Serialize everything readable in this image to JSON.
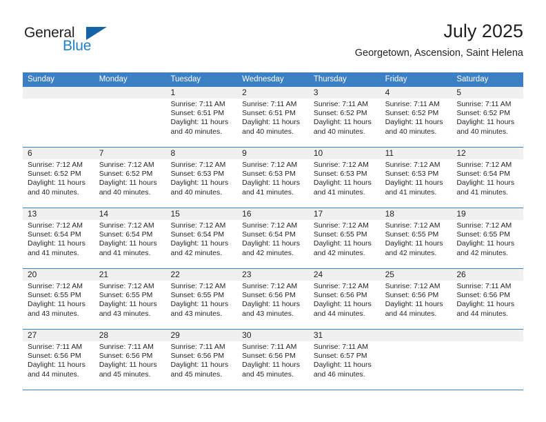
{
  "brand": {
    "name_top": "General",
    "name_bottom": "Blue",
    "triangle_color": "#1464a5",
    "blue_color": "#1f7fc4"
  },
  "header": {
    "title": "July 2025",
    "subtitle": "Georgetown, Ascension, Saint Helena"
  },
  "theme": {
    "header_blue": "#3b7fc4",
    "datenum_bg": "#f0f0f0",
    "text": "#231f20"
  },
  "weekdays": [
    "Sunday",
    "Monday",
    "Tuesday",
    "Wednesday",
    "Thursday",
    "Friday",
    "Saturday"
  ],
  "weeks": [
    [
      {
        "day": "",
        "sunrise": "",
        "sunset": "",
        "daylight1": "",
        "daylight2": ""
      },
      {
        "day": "",
        "sunrise": "",
        "sunset": "",
        "daylight1": "",
        "daylight2": ""
      },
      {
        "day": "1",
        "sunrise": "Sunrise: 7:11 AM",
        "sunset": "Sunset: 6:51 PM",
        "daylight1": "Daylight: 11 hours",
        "daylight2": "and 40 minutes."
      },
      {
        "day": "2",
        "sunrise": "Sunrise: 7:11 AM",
        "sunset": "Sunset: 6:51 PM",
        "daylight1": "Daylight: 11 hours",
        "daylight2": "and 40 minutes."
      },
      {
        "day": "3",
        "sunrise": "Sunrise: 7:11 AM",
        "sunset": "Sunset: 6:52 PM",
        "daylight1": "Daylight: 11 hours",
        "daylight2": "and 40 minutes."
      },
      {
        "day": "4",
        "sunrise": "Sunrise: 7:11 AM",
        "sunset": "Sunset: 6:52 PM",
        "daylight1": "Daylight: 11 hours",
        "daylight2": "and 40 minutes."
      },
      {
        "day": "5",
        "sunrise": "Sunrise: 7:11 AM",
        "sunset": "Sunset: 6:52 PM",
        "daylight1": "Daylight: 11 hours",
        "daylight2": "and 40 minutes."
      }
    ],
    [
      {
        "day": "6",
        "sunrise": "Sunrise: 7:12 AM",
        "sunset": "Sunset: 6:52 PM",
        "daylight1": "Daylight: 11 hours",
        "daylight2": "and 40 minutes."
      },
      {
        "day": "7",
        "sunrise": "Sunrise: 7:12 AM",
        "sunset": "Sunset: 6:52 PM",
        "daylight1": "Daylight: 11 hours",
        "daylight2": "and 40 minutes."
      },
      {
        "day": "8",
        "sunrise": "Sunrise: 7:12 AM",
        "sunset": "Sunset: 6:53 PM",
        "daylight1": "Daylight: 11 hours",
        "daylight2": "and 40 minutes."
      },
      {
        "day": "9",
        "sunrise": "Sunrise: 7:12 AM",
        "sunset": "Sunset: 6:53 PM",
        "daylight1": "Daylight: 11 hours",
        "daylight2": "and 41 minutes."
      },
      {
        "day": "10",
        "sunrise": "Sunrise: 7:12 AM",
        "sunset": "Sunset: 6:53 PM",
        "daylight1": "Daylight: 11 hours",
        "daylight2": "and 41 minutes."
      },
      {
        "day": "11",
        "sunrise": "Sunrise: 7:12 AM",
        "sunset": "Sunset: 6:53 PM",
        "daylight1": "Daylight: 11 hours",
        "daylight2": "and 41 minutes."
      },
      {
        "day": "12",
        "sunrise": "Sunrise: 7:12 AM",
        "sunset": "Sunset: 6:54 PM",
        "daylight1": "Daylight: 11 hours",
        "daylight2": "and 41 minutes."
      }
    ],
    [
      {
        "day": "13",
        "sunrise": "Sunrise: 7:12 AM",
        "sunset": "Sunset: 6:54 PM",
        "daylight1": "Daylight: 11 hours",
        "daylight2": "and 41 minutes."
      },
      {
        "day": "14",
        "sunrise": "Sunrise: 7:12 AM",
        "sunset": "Sunset: 6:54 PM",
        "daylight1": "Daylight: 11 hours",
        "daylight2": "and 41 minutes."
      },
      {
        "day": "15",
        "sunrise": "Sunrise: 7:12 AM",
        "sunset": "Sunset: 6:54 PM",
        "daylight1": "Daylight: 11 hours",
        "daylight2": "and 42 minutes."
      },
      {
        "day": "16",
        "sunrise": "Sunrise: 7:12 AM",
        "sunset": "Sunset: 6:54 PM",
        "daylight1": "Daylight: 11 hours",
        "daylight2": "and 42 minutes."
      },
      {
        "day": "17",
        "sunrise": "Sunrise: 7:12 AM",
        "sunset": "Sunset: 6:55 PM",
        "daylight1": "Daylight: 11 hours",
        "daylight2": "and 42 minutes."
      },
      {
        "day": "18",
        "sunrise": "Sunrise: 7:12 AM",
        "sunset": "Sunset: 6:55 PM",
        "daylight1": "Daylight: 11 hours",
        "daylight2": "and 42 minutes."
      },
      {
        "day": "19",
        "sunrise": "Sunrise: 7:12 AM",
        "sunset": "Sunset: 6:55 PM",
        "daylight1": "Daylight: 11 hours",
        "daylight2": "and 42 minutes."
      }
    ],
    [
      {
        "day": "20",
        "sunrise": "Sunrise: 7:12 AM",
        "sunset": "Sunset: 6:55 PM",
        "daylight1": "Daylight: 11 hours",
        "daylight2": "and 43 minutes."
      },
      {
        "day": "21",
        "sunrise": "Sunrise: 7:12 AM",
        "sunset": "Sunset: 6:55 PM",
        "daylight1": "Daylight: 11 hours",
        "daylight2": "and 43 minutes."
      },
      {
        "day": "22",
        "sunrise": "Sunrise: 7:12 AM",
        "sunset": "Sunset: 6:55 PM",
        "daylight1": "Daylight: 11 hours",
        "daylight2": "and 43 minutes."
      },
      {
        "day": "23",
        "sunrise": "Sunrise: 7:12 AM",
        "sunset": "Sunset: 6:56 PM",
        "daylight1": "Daylight: 11 hours",
        "daylight2": "and 43 minutes."
      },
      {
        "day": "24",
        "sunrise": "Sunrise: 7:12 AM",
        "sunset": "Sunset: 6:56 PM",
        "daylight1": "Daylight: 11 hours",
        "daylight2": "and 44 minutes."
      },
      {
        "day": "25",
        "sunrise": "Sunrise: 7:12 AM",
        "sunset": "Sunset: 6:56 PM",
        "daylight1": "Daylight: 11 hours",
        "daylight2": "and 44 minutes."
      },
      {
        "day": "26",
        "sunrise": "Sunrise: 7:11 AM",
        "sunset": "Sunset: 6:56 PM",
        "daylight1": "Daylight: 11 hours",
        "daylight2": "and 44 minutes."
      }
    ],
    [
      {
        "day": "27",
        "sunrise": "Sunrise: 7:11 AM",
        "sunset": "Sunset: 6:56 PM",
        "daylight1": "Daylight: 11 hours",
        "daylight2": "and 44 minutes."
      },
      {
        "day": "28",
        "sunrise": "Sunrise: 7:11 AM",
        "sunset": "Sunset: 6:56 PM",
        "daylight1": "Daylight: 11 hours",
        "daylight2": "and 45 minutes."
      },
      {
        "day": "29",
        "sunrise": "Sunrise: 7:11 AM",
        "sunset": "Sunset: 6:56 PM",
        "daylight1": "Daylight: 11 hours",
        "daylight2": "and 45 minutes."
      },
      {
        "day": "30",
        "sunrise": "Sunrise: 7:11 AM",
        "sunset": "Sunset: 6:56 PM",
        "daylight1": "Daylight: 11 hours",
        "daylight2": "and 45 minutes."
      },
      {
        "day": "31",
        "sunrise": "Sunrise: 7:11 AM",
        "sunset": "Sunset: 6:57 PM",
        "daylight1": "Daylight: 11 hours",
        "daylight2": "and 46 minutes."
      },
      {
        "day": "",
        "sunrise": "",
        "sunset": "",
        "daylight1": "",
        "daylight2": ""
      },
      {
        "day": "",
        "sunrise": "",
        "sunset": "",
        "daylight1": "",
        "daylight2": ""
      }
    ]
  ]
}
